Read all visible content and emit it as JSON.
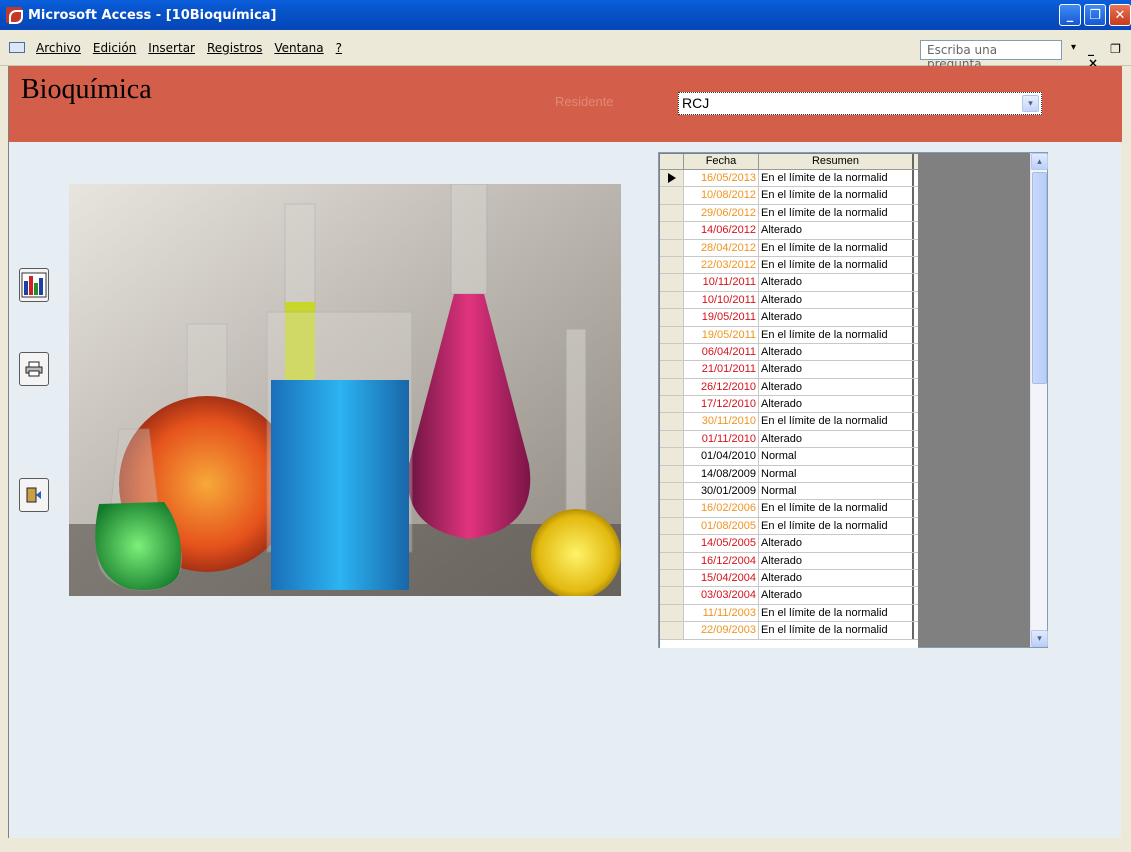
{
  "window": {
    "title": "Microsoft Access - [10Bioquímica]",
    "minimize": "_",
    "restore": "❐",
    "close": "✕"
  },
  "menu": {
    "items": [
      "Archivo",
      "Edición",
      "Insertar",
      "Registros",
      "Ventana",
      "?"
    ],
    "ask_placeholder": "Escriba una pregunta",
    "ask_arrow": "▾",
    "mdi_controls": "_ ❐ ×"
  },
  "form": {
    "title": "Bioquímica",
    "resident_label": "Residente",
    "resident_value": "RCJ",
    "combo_arrow": "▾"
  },
  "grid": {
    "headers": [
      "Fecha",
      "Resumen"
    ],
    "scroll_up": "▴",
    "scroll_down": "▾",
    "rows": [
      {
        "fecha": "16/05/2013",
        "resumen": "En el límite de la normalid",
        "color": "orange"
      },
      {
        "fecha": "10/08/2012",
        "resumen": "En el límite de la normalid",
        "color": "orange"
      },
      {
        "fecha": "29/06/2012",
        "resumen": "En el límite de la normalid",
        "color": "orange"
      },
      {
        "fecha": "14/06/2012",
        "resumen": "Alterado",
        "color": "red"
      },
      {
        "fecha": "28/04/2012",
        "resumen": "En el límite de la normalid",
        "color": "orange"
      },
      {
        "fecha": "22/03/2012",
        "resumen": "En el límite de la normalid",
        "color": "orange"
      },
      {
        "fecha": "10/11/2011",
        "resumen": "Alterado",
        "color": "red"
      },
      {
        "fecha": "10/10/2011",
        "resumen": "Alterado",
        "color": "red"
      },
      {
        "fecha": "19/05/2011",
        "resumen": "Alterado",
        "color": "red"
      },
      {
        "fecha": "19/05/2011",
        "resumen": "En el límite de la normalid",
        "color": "orange"
      },
      {
        "fecha": "06/04/2011",
        "resumen": "Alterado",
        "color": "red"
      },
      {
        "fecha": "21/01/2011",
        "resumen": "Alterado",
        "color": "red"
      },
      {
        "fecha": "26/12/2010",
        "resumen": "Alterado",
        "color": "red"
      },
      {
        "fecha": "17/12/2010",
        "resumen": "Alterado",
        "color": "red"
      },
      {
        "fecha": "30/11/2010",
        "resumen": "En el límite de la normalid",
        "color": "orange"
      },
      {
        "fecha": "01/11/2010",
        "resumen": "Alterado",
        "color": "red"
      },
      {
        "fecha": "01/04/2010",
        "resumen": "Normal",
        "color": "black"
      },
      {
        "fecha": "14/08/2009",
        "resumen": "Normal",
        "color": "black"
      },
      {
        "fecha": "30/01/2009",
        "resumen": "Normal",
        "color": "black"
      },
      {
        "fecha": "16/02/2006",
        "resumen": "En el límite de la normalid",
        "color": "orange"
      },
      {
        "fecha": "01/08/2005",
        "resumen": "En el límite de la normalid",
        "color": "orange"
      },
      {
        "fecha": "14/05/2005",
        "resumen": "Alterado",
        "color": "red"
      },
      {
        "fecha": "16/12/2004",
        "resumen": "Alterado",
        "color": "red"
      },
      {
        "fecha": "15/04/2004",
        "resumen": "Alterado",
        "color": "red"
      },
      {
        "fecha": "03/03/2004",
        "resumen": "Alterado",
        "color": "red"
      },
      {
        "fecha": "11/11/2003",
        "resumen": "En el límite de la normalid",
        "color": "orange"
      },
      {
        "fecha": "22/09/2003",
        "resumen": "En el límite de la normalid",
        "color": "orange"
      }
    ]
  },
  "colors": {
    "header_bg": "#d35f4a",
    "form_bg": "#e6edf3",
    "orange": "#f0941e",
    "red": "#d6121b"
  }
}
